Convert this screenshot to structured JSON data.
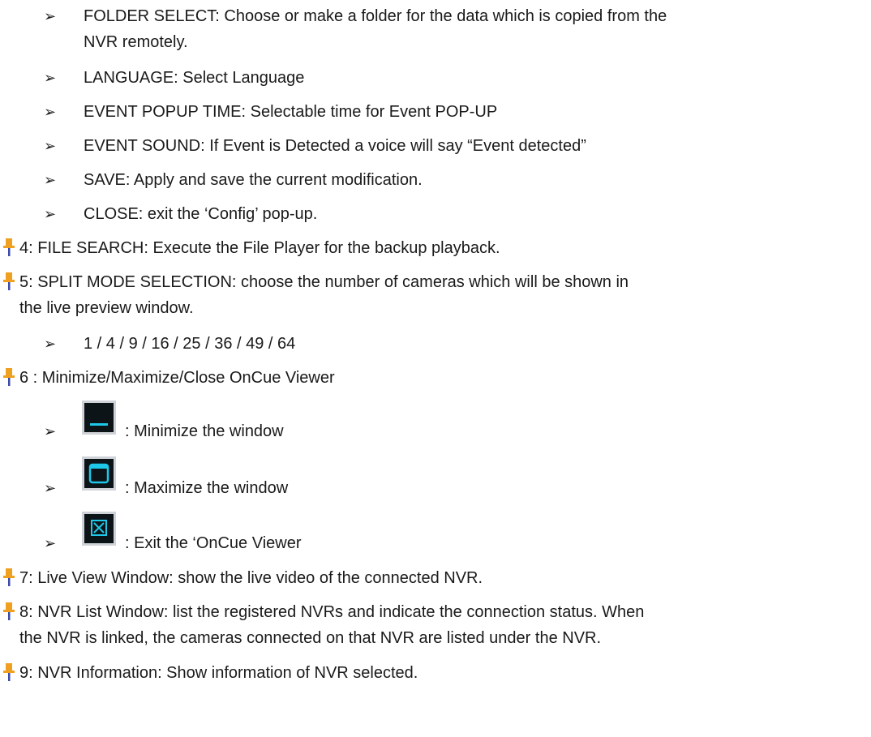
{
  "sub_bullet_glyph": "➢",
  "config_items": [
    {
      "line1": "FOLDER SELECT: Choose or make a folder for the data which is copied from the",
      "line2": "NVR remotely."
    },
    {
      "line1": "LANGUAGE: Select Language"
    },
    {
      "line1": "EVENT POPUP TIME: Selectable time for Event POP-UP"
    },
    {
      "line1": "EVENT SOUND: If Event is Detected a voice will say “Event detected”"
    },
    {
      "line1": "SAVE: Apply and save the current modification."
    },
    {
      "line1": "CLOSE: exit the ‘Config’ pop-up."
    }
  ],
  "item4": {
    "line1": "4: FILE SEARCH: Execute the File Player for the backup playback."
  },
  "item5": {
    "line1": "5: SPLIT MODE SELECTION: choose the number of cameras which will be shown in",
    "line2": "the live preview window.",
    "sub": "1 / 4 / 9 / 16 / 25 / 36 / 49 / 64"
  },
  "item6": {
    "line1": "6 : Minimize/Maximize/Close OnCue Viewer",
    "buttons": [
      {
        "icon": "minimize-icon",
        "text": ": Minimize the window"
      },
      {
        "icon": "maximize-icon",
        "text": ": Maximize the window"
      },
      {
        "icon": "close-icon",
        "text": ": Exit the ‘OnCue Viewer"
      }
    ]
  },
  "item7": {
    "line1": "7: Live View Window: show the live video of the connected NVR."
  },
  "item8": {
    "line1": "8: NVR List Window: list the registered NVRs and indicate the connection status. When",
    "line2": "the NVR is linked, the cameras connected on that NVR are listed under the NVR."
  },
  "item9": {
    "line1": "9: NVR Information: Show information of NVR selected."
  },
  "colors": {
    "pin_head": "#f0a020",
    "pin_needle": "#3b4aa8",
    "icon_frame": "#cfd3d8",
    "icon_bg": "#0d1418",
    "icon_accent": "#1ec8e8"
  }
}
